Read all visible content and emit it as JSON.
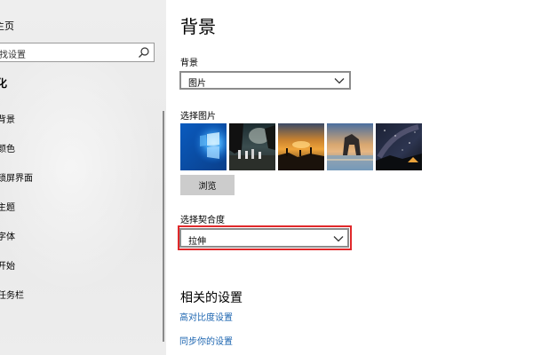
{
  "sidebar": {
    "home_label": "主页",
    "search_placeholder": "找设置",
    "section_label": "化",
    "items": [
      {
        "label": "背景"
      },
      {
        "label": "颜色"
      },
      {
        "label": "锁屏界面"
      },
      {
        "label": "主题"
      },
      {
        "label": "字体"
      },
      {
        "label": "开始"
      },
      {
        "label": "任务栏"
      }
    ]
  },
  "main": {
    "title": "背景",
    "background": {
      "label": "背景",
      "value": "图片"
    },
    "choose_picture": {
      "label": "选择图片",
      "thumbnails": [
        {
          "name": "windows-hero-blue"
        },
        {
          "name": "beach-rocks-night"
        },
        {
          "name": "sunset-figures"
        },
        {
          "name": "rock-arch-sunset"
        },
        {
          "name": "starry-night-tent"
        }
      ],
      "browse_label": "浏览"
    },
    "fit": {
      "label": "选择契合度",
      "value": "拉伸"
    },
    "related": {
      "title": "相关的设置",
      "links": [
        {
          "label": "高对比度设置"
        },
        {
          "label": "同步你的设置"
        }
      ]
    }
  },
  "colors": {
    "link": "#1b64b0",
    "highlight_border": "#e0282a",
    "button_bg": "#cccccc",
    "sidebar_bg": "#ececec"
  }
}
